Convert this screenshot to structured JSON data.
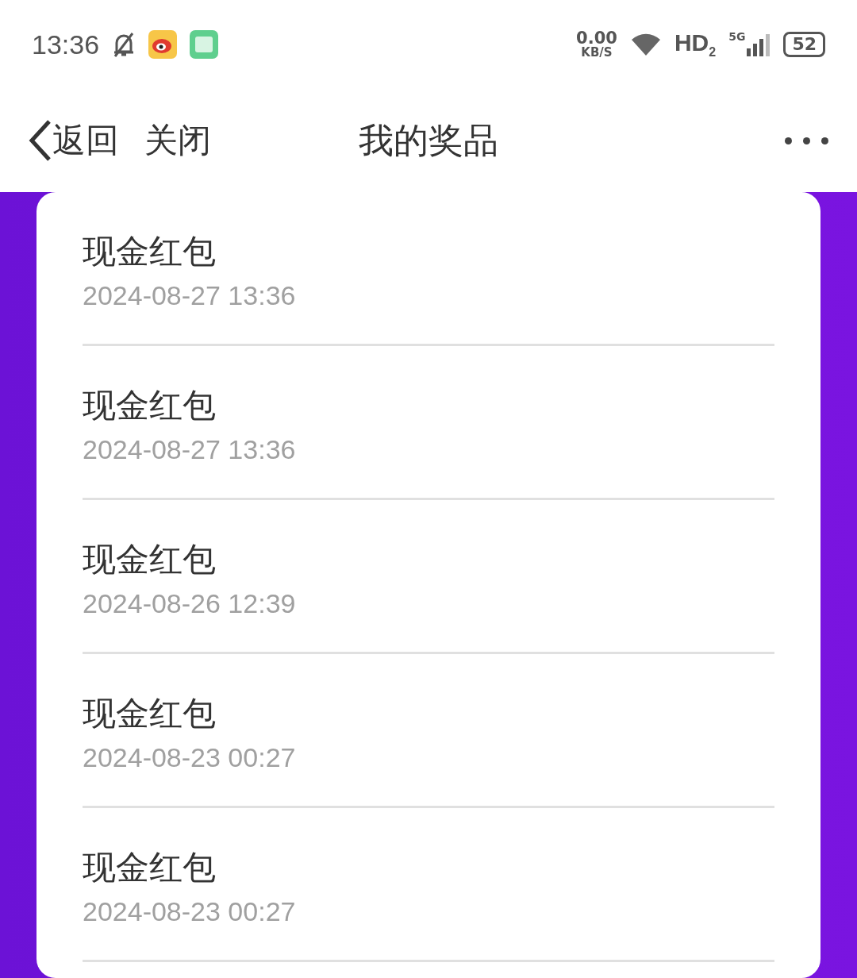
{
  "status_bar": {
    "time": "13:36",
    "speed_value": "0.00",
    "speed_unit": "KB/S",
    "hd": "HD",
    "hd_sub": "2",
    "network": "5G",
    "battery": "52"
  },
  "nav": {
    "back": "返回",
    "close": "关闭",
    "title": "我的奖品"
  },
  "prizes": [
    {
      "name": "现金红包",
      "time": "2024-08-27 13:36"
    },
    {
      "name": "现金红包",
      "time": "2024-08-27 13:36"
    },
    {
      "name": "现金红包",
      "time": "2024-08-26 12:39"
    },
    {
      "name": "现金红包",
      "time": "2024-08-23 00:27"
    },
    {
      "name": "现金红包",
      "time": "2024-08-23 00:27"
    }
  ]
}
